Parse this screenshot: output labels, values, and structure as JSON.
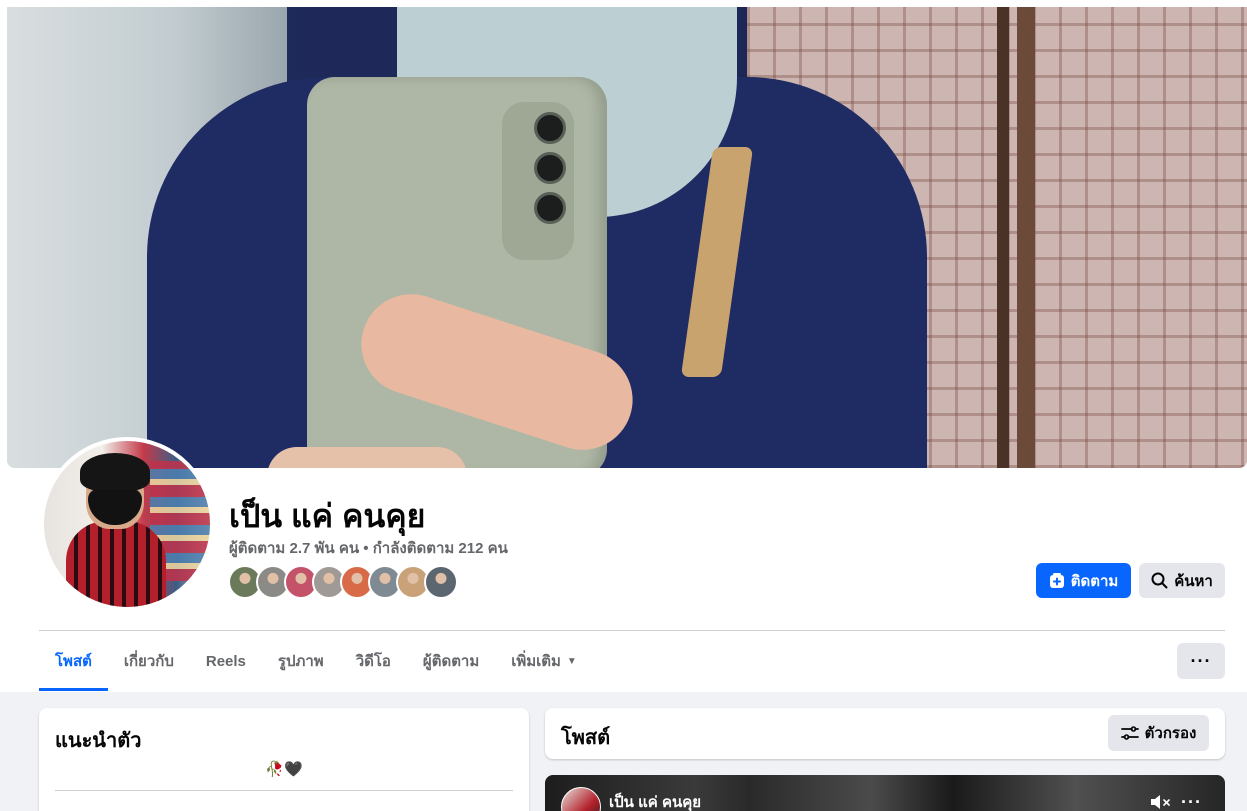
{
  "profile": {
    "name": "เป็น แค่ คนคุย",
    "stats": "ผู้ติดตาม 2.7 พัน คน • กำลังติดตาม 212 คน"
  },
  "friends": {
    "colors": [
      "#6b7a5a",
      "#8c8a86",
      "#c4536a",
      "#9f9a95",
      "#d96a48",
      "#7f8a93",
      "#c9a27a",
      "#5b6670"
    ]
  },
  "actions": {
    "follow_label": "ติดตาม",
    "search_label": "ค้นหา",
    "more_label": "···"
  },
  "tabs": [
    {
      "label": "โพสต์",
      "active": true
    },
    {
      "label": "เกี่ยวกับ",
      "active": false
    },
    {
      "label": "Reels",
      "active": false
    },
    {
      "label": "รูปภาพ",
      "active": false
    },
    {
      "label": "วิดีโอ",
      "active": false
    },
    {
      "label": "ผู้ติดตาม",
      "active": false
    },
    {
      "label": "เพิ่มเติม",
      "active": false
    }
  ],
  "intro": {
    "title": "แนะนำตัว",
    "bio": "🥀🖤"
  },
  "posts": {
    "title": "โพสต์",
    "filter_label": "ตัวกรอง"
  },
  "video_post": {
    "author": "เป็น แค่ คนคุย",
    "dots": "···"
  },
  "colors": {
    "accent": "#0866ff",
    "background": "#f0f2f5",
    "button_gray": "#e4e6eb",
    "text_secondary": "#65676b"
  }
}
